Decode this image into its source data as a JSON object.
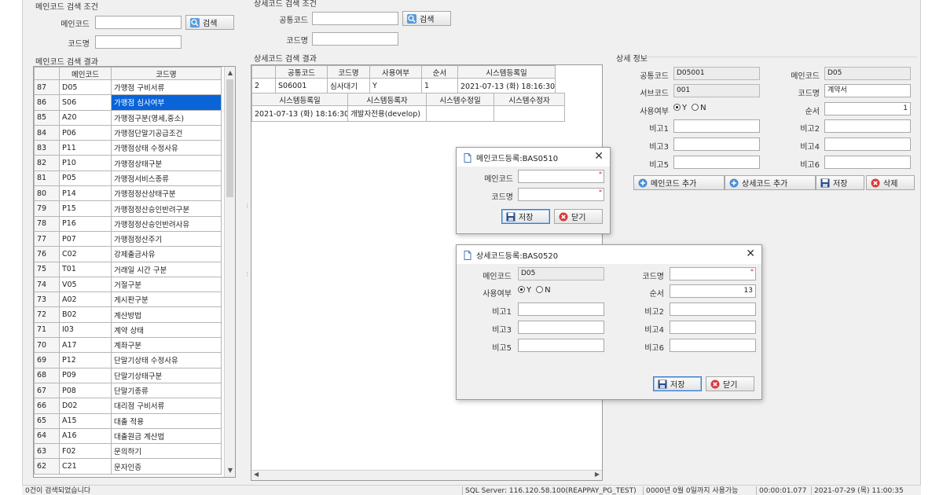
{
  "main_search": {
    "title": "메인코드 검색 조건",
    "main_code_label": "메인코드",
    "main_code_value": "",
    "search_label": "검색",
    "code_name_label": "코드명",
    "code_name_value": ""
  },
  "main_results": {
    "title": "메인코드 검색 결과",
    "columns": [
      "메인코드",
      "코드명"
    ],
    "rows": [
      {
        "idx": "87",
        "code": "D05",
        "name": "가맹점 구비서류"
      },
      {
        "idx": "86",
        "code": "S06",
        "name": "가맹점 심사여부"
      },
      {
        "idx": "85",
        "code": "A20",
        "name": "가맹점구분(영세,중소)"
      },
      {
        "idx": "84",
        "code": "P06",
        "name": "가맹점단말기공급조건"
      },
      {
        "idx": "83",
        "code": "P11",
        "name": "가맹점상태 수정사유"
      },
      {
        "idx": "82",
        "code": "P10",
        "name": "가맹점상태구분"
      },
      {
        "idx": "81",
        "code": "P05",
        "name": "가맹점서비스종류"
      },
      {
        "idx": "80",
        "code": "P14",
        "name": "가맹점정산상태구분"
      },
      {
        "idx": "79",
        "code": "P15",
        "name": "가맹점정산승인반려구분"
      },
      {
        "idx": "78",
        "code": "P16",
        "name": "가맹점정산승인반려사유"
      },
      {
        "idx": "77",
        "code": "P07",
        "name": "가맹점정산주기"
      },
      {
        "idx": "76",
        "code": "C02",
        "name": "강제출금사유"
      },
      {
        "idx": "75",
        "code": "T01",
        "name": "거래일 시간 구분"
      },
      {
        "idx": "74",
        "code": "V05",
        "name": "거절구분"
      },
      {
        "idx": "73",
        "code": "A02",
        "name": "게시판구분"
      },
      {
        "idx": "72",
        "code": "B02",
        "name": "계산방법"
      },
      {
        "idx": "71",
        "code": "I03",
        "name": "계약 상태"
      },
      {
        "idx": "70",
        "code": "A17",
        "name": "계좌구분"
      },
      {
        "idx": "69",
        "code": "P12",
        "name": "단말기상태 수정사유"
      },
      {
        "idx": "68",
        "code": "P09",
        "name": "단말기상태구분"
      },
      {
        "idx": "67",
        "code": "P08",
        "name": "단말기종류"
      },
      {
        "idx": "66",
        "code": "D02",
        "name": "대리점 구비서류"
      },
      {
        "idx": "65",
        "code": "A15",
        "name": "대출 적용"
      },
      {
        "idx": "64",
        "code": "A16",
        "name": "대출원금 계산법"
      },
      {
        "idx": "63",
        "code": "F02",
        "name": "문의하기"
      },
      {
        "idx": "62",
        "code": "C21",
        "name": "문자인증"
      }
    ]
  },
  "detail_search": {
    "title": "상세코드 검색 조건",
    "common_code_label": "공통코드",
    "common_code_value": "",
    "search_label": "검색",
    "code_name_label": "코드명",
    "code_name_value": ""
  },
  "detail_results": {
    "title": "상세코드 검색 결과",
    "columns": [
      "공통코드",
      "코드명",
      "사용여부",
      "순서",
      "시스템등록일"
    ],
    "row": {
      "idx": "2",
      "common_code": "S06001",
      "code_name": "심사대기",
      "use_yn": "Y",
      "order": "1",
      "reg_date": "2021-07-13 (화) 18:16:30"
    },
    "columns2": [
      "시스템등록일",
      "시스템등록자",
      "시스템수정일",
      "시스템수정자"
    ],
    "row2": {
      "reg_date": "2021-07-13 (화) 18:16:30",
      "reg_user": "개발자전용(develop)",
      "mod_date": "",
      "mod_user": ""
    }
  },
  "detail_info": {
    "title": "상세 정보",
    "common_code_label": "공통코드",
    "common_code_value": "D05001",
    "main_code_label": "메인코드",
    "main_code_value": "D05",
    "sub_code_label": "서브코드",
    "sub_code_value": "001",
    "code_name_label": "코드명",
    "code_name_value": "계약서",
    "use_label": "사용여부",
    "use_y": "Y",
    "use_n": "N",
    "order_label": "순서",
    "order_value": "1",
    "note1_label": "비고1",
    "note2_label": "비고2",
    "note3_label": "비고3",
    "note4_label": "비고4",
    "note5_label": "비고5",
    "note6_label": "비고6",
    "add_main_label": "메인코드 추가",
    "add_detail_label": "상세코드 추가",
    "save_label": "저장",
    "delete_label": "삭제"
  },
  "dialog_main": {
    "title": "메인코드등록:BAS0510",
    "main_code_label": "메인코드",
    "code_name_label": "코드명",
    "save_label": "저장",
    "close_label": "닫기"
  },
  "dialog_detail": {
    "title": "상세코드등록:BAS0520",
    "main_code_label": "메인코드",
    "main_code_value": "D05",
    "code_name_label": "코드명",
    "use_label": "사용여부",
    "use_y": "Y",
    "use_n": "N",
    "order_label": "순서",
    "order_value": "13",
    "note1_label": "비고1",
    "note2_label": "비고2",
    "note3_label": "비고3",
    "note4_label": "비고4",
    "note5_label": "비고5",
    "note6_label": "비고6",
    "save_label": "저장",
    "close_label": "닫기"
  },
  "status": {
    "message": "0건이 검색되었습니다",
    "server": "SQL Server: 116.120.58.100(REAPPAY_PG_TEST)",
    "usage": "0000년 0월 0일까지 사용가능",
    "elapsed": "00:00:01.077",
    "datetime": "2021-07-29 (목) 11:00:35"
  },
  "colors": {
    "selection": "#0a64d8",
    "required": "#e02020",
    "window": "#f0f0f0"
  }
}
